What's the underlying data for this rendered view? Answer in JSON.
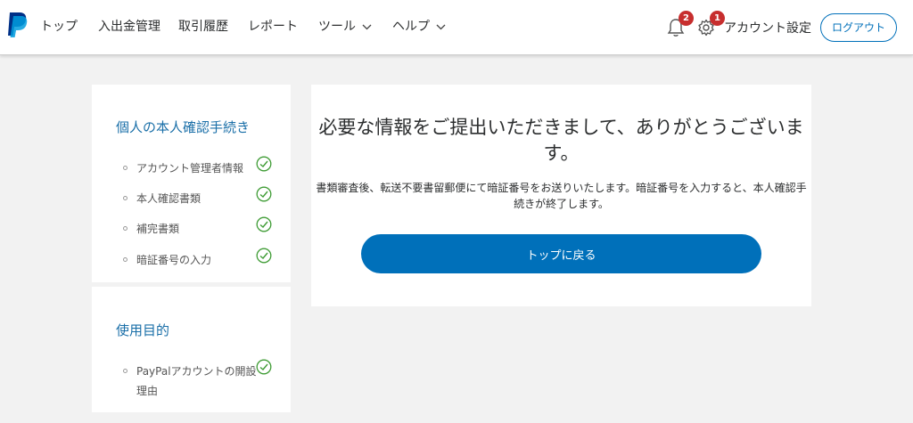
{
  "header": {
    "logo": "PayPal",
    "nav": [
      {
        "label": "トップ",
        "dropdown": false
      },
      {
        "label": "入出金管理",
        "dropdown": false
      },
      {
        "label": "取引履歴",
        "dropdown": false
      },
      {
        "label": "レポート",
        "dropdown": false
      },
      {
        "label": "ツール",
        "dropdown": true
      },
      {
        "label": "ヘルプ",
        "dropdown": true
      }
    ],
    "notifications_count": "2",
    "settings_count": "1",
    "account_settings": "アカウント設定",
    "logout": "ログアウト"
  },
  "sidebar": {
    "verification": {
      "title": "個人の本人確認手続き",
      "steps": [
        {
          "label": "アカウント管理者情報",
          "done": true
        },
        {
          "label": "本人確認書類",
          "done": true
        },
        {
          "label": "補完書類",
          "done": true
        },
        {
          "label": "暗証番号の入力",
          "done": true
        }
      ]
    },
    "purpose": {
      "title": "使用目的",
      "steps": [
        {
          "label": "PayPalアカウントの開設理由",
          "done": true
        }
      ]
    }
  },
  "main": {
    "title": "必要な情報をご提出いただきまして、ありがとうございます。",
    "description": "書類審査後、転送不要書留郵便にて暗証番号をお送りいたします。暗証番号を入力すると、本人確認手続きが終了します。",
    "button": "トップに戻る"
  },
  "colors": {
    "brand": "#0070ba",
    "check": "#3f9c35",
    "badge": "#c72e2e",
    "link_title": "#1a6fa8"
  }
}
